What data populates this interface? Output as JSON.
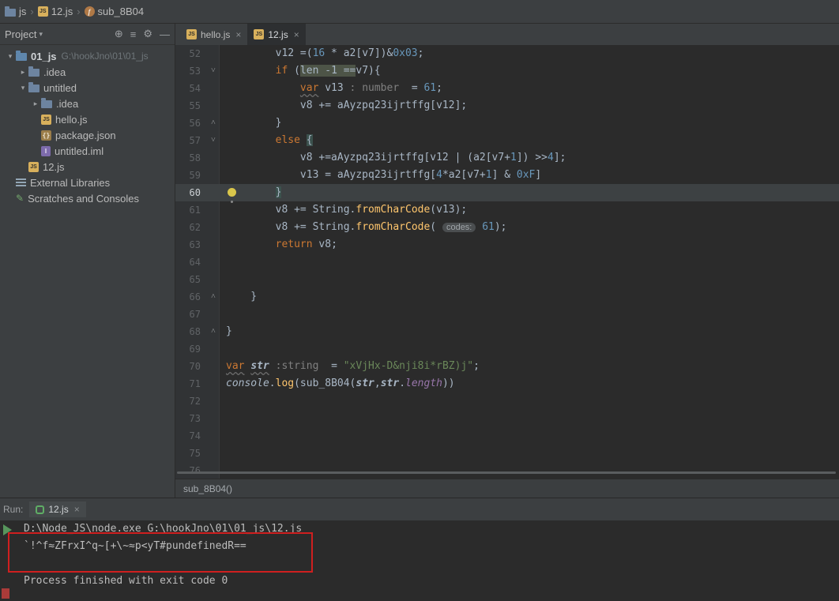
{
  "top_breadcrumbs": {
    "items": [
      {
        "label": "js",
        "icon": "folder"
      },
      {
        "label": "12.js",
        "icon": "js"
      },
      {
        "label": "sub_8B04",
        "icon": "fn"
      }
    ]
  },
  "project_panel": {
    "title": "Project",
    "caret": "▾",
    "toolbar_icons": [
      {
        "name": "locate-icon",
        "glyph": "⊕"
      },
      {
        "name": "collapse-all-icon",
        "glyph": "≡"
      },
      {
        "name": "settings-icon",
        "glyph": "⚙"
      },
      {
        "name": "hide-icon",
        "glyph": "—"
      }
    ],
    "tree": [
      {
        "label": "01_js",
        "path": "G:\\hookJno\\01\\01_js",
        "icon": "folder-root",
        "depth": 0,
        "arrow": "expanded",
        "bold": true
      },
      {
        "label": ".idea",
        "icon": "folder",
        "depth": 1,
        "arrow": "collapsed"
      },
      {
        "label": "untitled",
        "icon": "folder",
        "depth": 1,
        "arrow": "expanded"
      },
      {
        "label": ".idea",
        "icon": "folder",
        "depth": 2,
        "arrow": "collapsed"
      },
      {
        "label": "hello.js",
        "icon": "js",
        "depth": 2
      },
      {
        "label": "package.json",
        "icon": "json",
        "depth": 2
      },
      {
        "label": "untitled.iml",
        "icon": "iml",
        "depth": 2
      },
      {
        "label": "12.js",
        "icon": "js",
        "depth": 1
      },
      {
        "label": "External Libraries",
        "icon": "lib",
        "depth": 0
      },
      {
        "label": "Scratches and Consoles",
        "icon": "scr",
        "depth": 0
      }
    ]
  },
  "editor": {
    "tabs": [
      {
        "label": "hello.js",
        "icon": "js",
        "active": false
      },
      {
        "label": "12.js",
        "icon": "js",
        "active": true
      }
    ],
    "breadcrumb": "sub_8B04()",
    "lines": [
      {
        "no": 52,
        "tokens": [
          {
            "t": "        v12 =(",
            "c": "d"
          },
          {
            "t": "16",
            "c": "n"
          },
          {
            "t": " * a2[v7])&",
            "c": "d"
          },
          {
            "t": "0x03",
            "c": "n"
          },
          {
            "t": ";",
            "c": "d"
          }
        ]
      },
      {
        "no": 53,
        "fold": "down",
        "tokens": [
          {
            "t": "        ",
            "c": "d"
          },
          {
            "t": "if",
            "c": "k"
          },
          {
            "t": " (",
            "c": "d"
          },
          {
            "t": "len -1 ==",
            "c": "d",
            "sel": true
          },
          {
            "t": "v7){",
            "c": "d"
          }
        ]
      },
      {
        "no": 54,
        "tokens": [
          {
            "t": "            ",
            "c": "d"
          },
          {
            "t": "var",
            "c": "k",
            "u": true
          },
          {
            "t": " v13 ",
            "c": "d"
          },
          {
            "t": ": number ",
            "c": "h"
          },
          {
            "t": " = ",
            "c": "d"
          },
          {
            "t": "61",
            "c": "n"
          },
          {
            "t": ";",
            "c": "d"
          }
        ]
      },
      {
        "no": 55,
        "tokens": [
          {
            "t": "            v8 += aAyzpq23ijrtffg[v12];",
            "c": "d"
          }
        ]
      },
      {
        "no": 56,
        "fold": "up",
        "tokens": [
          {
            "t": "        }",
            "c": "d"
          }
        ]
      },
      {
        "no": 57,
        "fold": "down",
        "tokens": [
          {
            "t": "        ",
            "c": "d"
          },
          {
            "t": "else",
            "c": "k"
          },
          {
            "t": " ",
            "c": "d"
          },
          {
            "t": "{",
            "c": "d",
            "brace": true
          }
        ]
      },
      {
        "no": 58,
        "tokens": [
          {
            "t": "            v8 +=aAyzpq23ijrtffg[v12 | (a2[v7+",
            "c": "d"
          },
          {
            "t": "1",
            "c": "n"
          },
          {
            "t": "]) >>",
            "c": "d"
          },
          {
            "t": "4",
            "c": "n"
          },
          {
            "t": "];",
            "c": "d"
          }
        ]
      },
      {
        "no": 59,
        "tokens": [
          {
            "t": "            v13 = aAyzpq23ijrtffg[",
            "c": "d"
          },
          {
            "t": "4",
            "c": "n"
          },
          {
            "t": "*a2[v7+",
            "c": "d"
          },
          {
            "t": "1",
            "c": "n"
          },
          {
            "t": "] & ",
            "c": "d"
          },
          {
            "t": "0xF",
            "c": "n"
          },
          {
            "t": "]",
            "c": "d"
          }
        ]
      },
      {
        "no": 60,
        "current": true,
        "bulb": true,
        "tokens": [
          {
            "t": "        ",
            "c": "d"
          },
          {
            "t": "}",
            "c": "d",
            "brace": true
          }
        ]
      },
      {
        "no": 61,
        "tokens": [
          {
            "t": "        v8 += String.",
            "c": "d"
          },
          {
            "t": "fromCharCode",
            "c": "f"
          },
          {
            "t": "(v13);",
            "c": "d"
          }
        ]
      },
      {
        "no": 62,
        "tokens": [
          {
            "t": "        v8 += String.",
            "c": "d"
          },
          {
            "t": "fromCharCode",
            "c": "f"
          },
          {
            "t": "( ",
            "c": "d"
          },
          {
            "t": "codes:",
            "c": "h",
            "chip": true
          },
          {
            "t": " ",
            "c": "d"
          },
          {
            "t": "61",
            "c": "n"
          },
          {
            "t": ");",
            "c": "d"
          }
        ]
      },
      {
        "no": 63,
        "tokens": [
          {
            "t": "        ",
            "c": "d"
          },
          {
            "t": "return",
            "c": "k"
          },
          {
            "t": " v8;",
            "c": "d"
          }
        ]
      },
      {
        "no": 64,
        "tokens": []
      },
      {
        "no": 65,
        "tokens": []
      },
      {
        "no": 66,
        "fold": "up",
        "tokens": [
          {
            "t": "    }",
            "c": "d"
          }
        ]
      },
      {
        "no": 67,
        "tokens": []
      },
      {
        "no": 68,
        "fold": "up",
        "tokens": [
          {
            "t": "}",
            "c": "d"
          }
        ]
      },
      {
        "no": 69,
        "tokens": []
      },
      {
        "no": 70,
        "tokens": [
          {
            "t": "var",
            "c": "k",
            "u": true
          },
          {
            "t": " ",
            "c": "d"
          },
          {
            "t": "str",
            "c": "bi",
            "u": true
          },
          {
            "t": " ",
            "c": "d"
          },
          {
            "t": ":string ",
            "c": "h"
          },
          {
            "t": " = ",
            "c": "d"
          },
          {
            "t": "\"xVjHx-D&nji8i*rBZ)j\"",
            "c": "s"
          },
          {
            "t": ";",
            "c": "d"
          }
        ]
      },
      {
        "no": 71,
        "tokens": [
          {
            "t": "console",
            "c": "i"
          },
          {
            "t": ".",
            "c": "d"
          },
          {
            "t": "log",
            "c": "f"
          },
          {
            "t": "(sub_8B04(",
            "c": "d"
          },
          {
            "t": "str",
            "c": "bi"
          },
          {
            "t": ",",
            "c": "d"
          },
          {
            "t": "str",
            "c": "bi"
          },
          {
            "t": ".",
            "c": "d"
          },
          {
            "t": "length",
            "c": "p"
          },
          {
            "t": "))",
            "c": "d"
          }
        ]
      },
      {
        "no": 72,
        "tokens": []
      },
      {
        "no": 73,
        "tokens": []
      },
      {
        "no": 74,
        "tokens": []
      },
      {
        "no": 75,
        "tokens": []
      },
      {
        "no": 76,
        "tokens": []
      }
    ]
  },
  "run_panel": {
    "label": "Run:",
    "tab": {
      "label": "12.js",
      "icon": "run"
    },
    "console_lines": [
      "D:\\Node_JS\\node.exe G:\\hookJno\\01\\01_js\\12.js",
      "`!^f≈ZFrxI^q~[+\\~≈p<yT#pundefinedR==",
      "",
      "Process finished with exit code 0"
    ]
  }
}
